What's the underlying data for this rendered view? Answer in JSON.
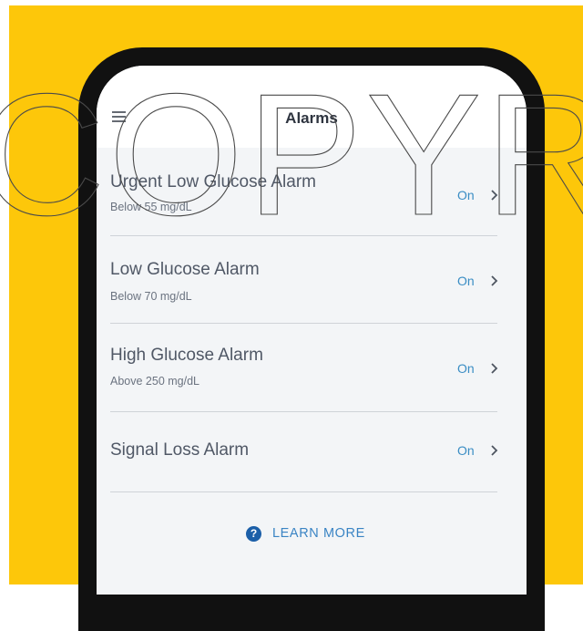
{
  "screen": {
    "title": "Alarms"
  },
  "alarms": [
    {
      "name": "Urgent Low Glucose Alarm",
      "threshold": "Below 55 mg/dL",
      "state": "On"
    },
    {
      "name": "Low Glucose Alarm",
      "threshold": "Below 70 mg/dL",
      "state": "On"
    },
    {
      "name": "High Glucose Alarm",
      "threshold": "Above 250 mg/dL",
      "state": "On"
    },
    {
      "name": "Signal Loss Alarm",
      "threshold": "",
      "state": "On"
    }
  ],
  "footer": {
    "learn_more_label": "LEARN MORE"
  },
  "watermark": {
    "text": "COPYRIGHT"
  },
  "colors": {
    "background": "#fdc70a",
    "accent": "#3a8dc4",
    "info_icon": "#1b5fa8"
  },
  "icons": {
    "menu": "hamburger-menu-icon",
    "row_arrow": "chevron-right-icon",
    "info": "info-circle-icon"
  }
}
